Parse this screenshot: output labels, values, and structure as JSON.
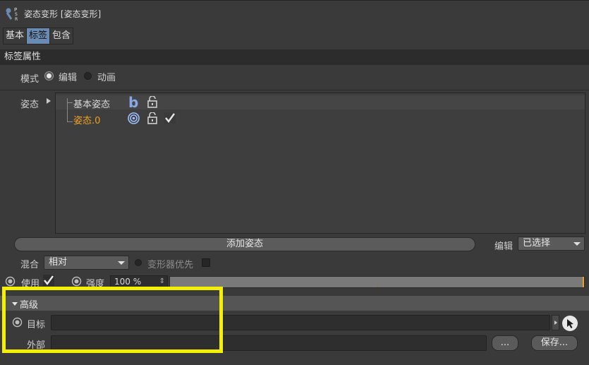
{
  "header": {
    "title": "姿态变形 [姿态变形]",
    "icon": "pose-morph-tag-icon"
  },
  "tabs": [
    {
      "label": "基本",
      "active": false
    },
    {
      "label": "标签",
      "active": true
    },
    {
      "label": "包含",
      "active": false
    }
  ],
  "section": {
    "title": "标签属性"
  },
  "mode": {
    "label": "模式",
    "options": [
      {
        "label": "编辑",
        "selected": true
      },
      {
        "label": "动画",
        "selected": false
      }
    ]
  },
  "poses": {
    "label": "姿态",
    "items": [
      {
        "name": "基本姿态",
        "icon": "base-pose-b-icon",
        "locked": false,
        "checked": false
      },
      {
        "name": "姿态.0",
        "icon": "target-icon",
        "locked": false,
        "checked": true
      }
    ]
  },
  "add_pose_button": "添加姿态",
  "edit": {
    "label": "编辑",
    "value": "已选择"
  },
  "mix": {
    "label": "混合",
    "value": "相对"
  },
  "deformer_priority": {
    "label": "变形器优先",
    "checked": false
  },
  "use": {
    "label": "使用",
    "checked": true
  },
  "strength": {
    "label": "强度",
    "value": "100 %",
    "level": 1.0
  },
  "advanced": {
    "title": "高级",
    "target_label": "目标",
    "external_label": "外部",
    "browse_button": "...",
    "save_button": "保存..."
  },
  "colors": {
    "active_tab": "#6a8cb4",
    "selected_pose": "#f0a020",
    "highlight": "#f5f000"
  }
}
